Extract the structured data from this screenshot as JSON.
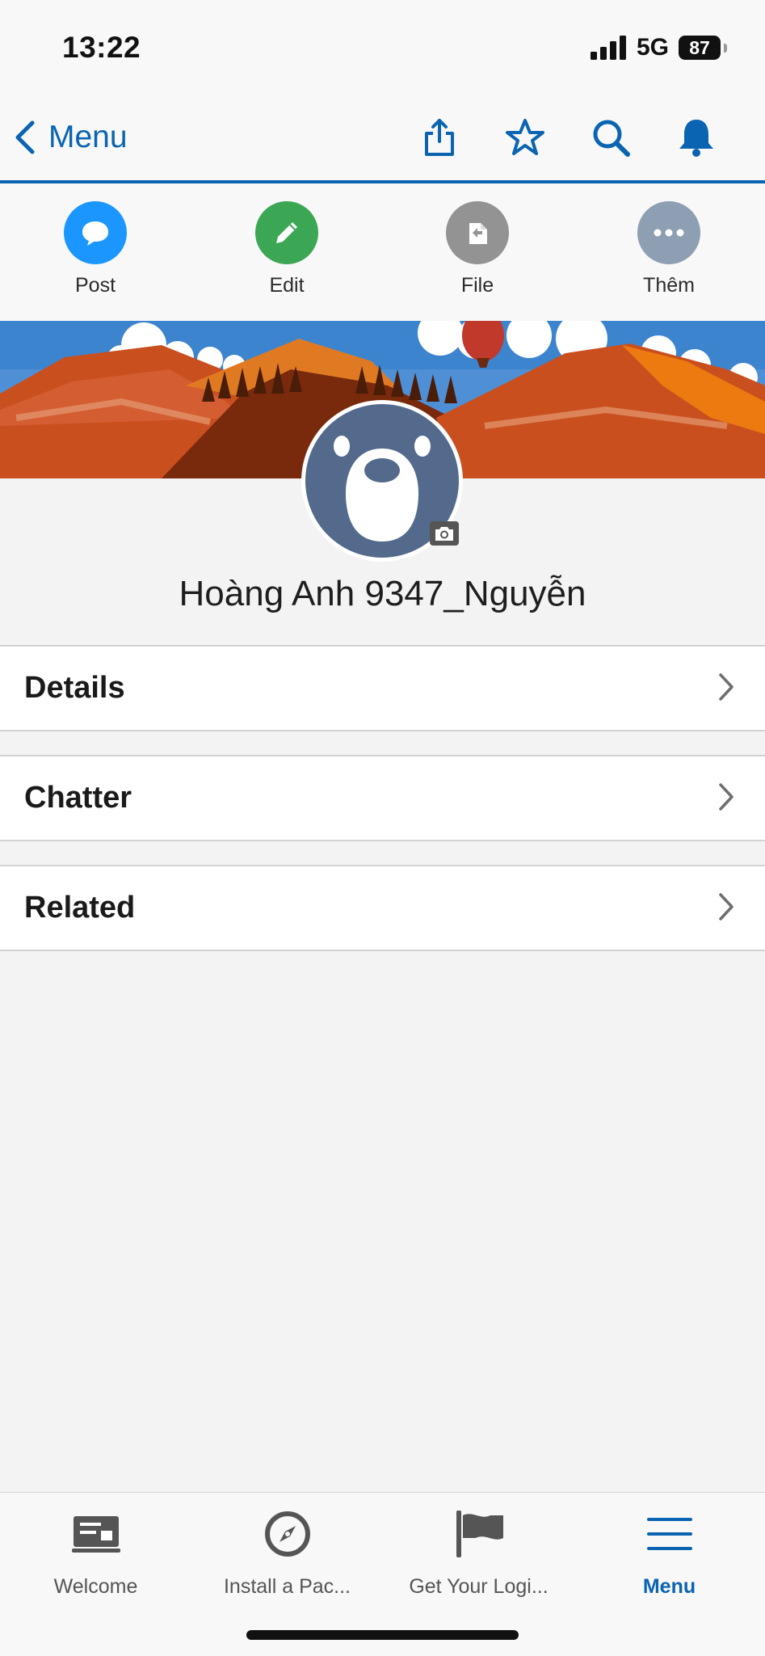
{
  "status_bar": {
    "time": "13:22",
    "network": "5G",
    "battery": "87"
  },
  "nav": {
    "back_label": "Menu"
  },
  "actions": [
    {
      "label": "Post",
      "color": "#1b96ff",
      "icon": "chat-bubble-icon"
    },
    {
      "label": "Edit",
      "color": "#3ba755",
      "icon": "pencil-icon"
    },
    {
      "label": "File",
      "color": "#939393",
      "icon": "file-upload-icon"
    },
    {
      "label": "Thêm",
      "color": "#8e9eb3",
      "icon": "more-icon"
    }
  ],
  "profile": {
    "name": "Hoàng Anh 9347_Nguyễn"
  },
  "sections": [
    {
      "label": "Details"
    },
    {
      "label": "Chatter"
    },
    {
      "label": "Related"
    }
  ],
  "tabs": [
    {
      "label": "Welcome",
      "icon": "welcome-icon",
      "active": false
    },
    {
      "label": "Install a Pac...",
      "icon": "compass-icon",
      "active": false
    },
    {
      "label": "Get Your Logi...",
      "icon": "flag-icon",
      "active": false
    },
    {
      "label": "Menu",
      "icon": "hamburger-icon",
      "active": true
    }
  ],
  "colors": {
    "accent": "#0a64b2",
    "background": "#f3f3f3"
  }
}
